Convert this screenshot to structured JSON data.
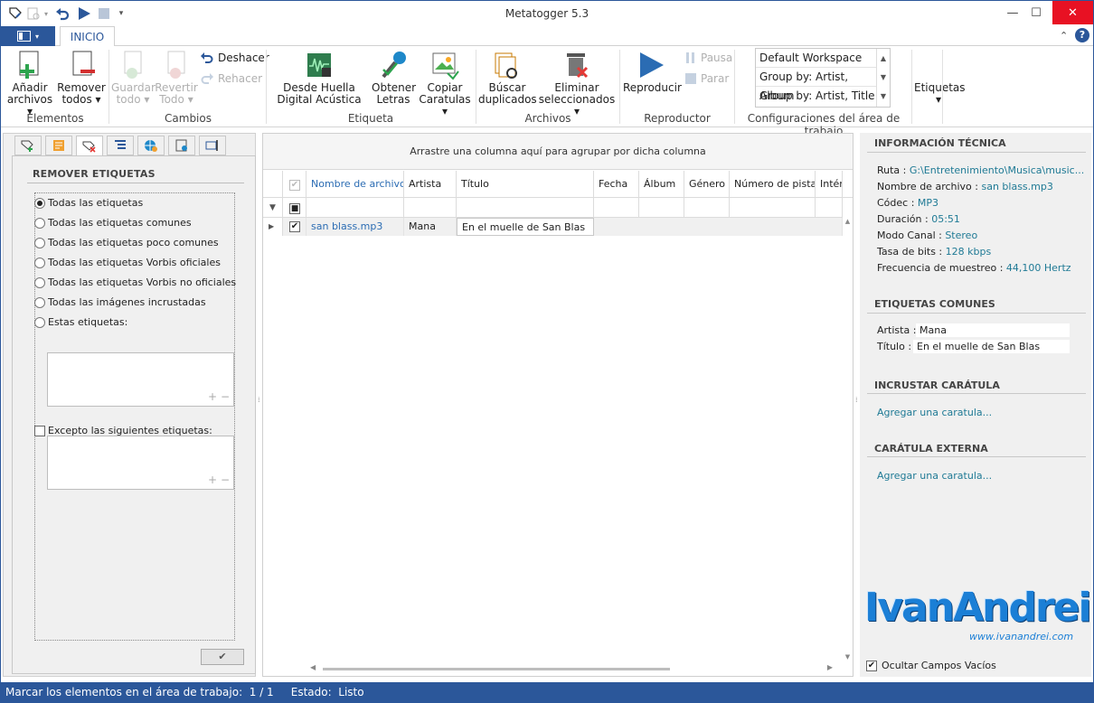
{
  "window": {
    "title": "Metatogger 5.3"
  },
  "ribbon_tabs": {
    "file_label": "",
    "inicio": "INICIO"
  },
  "ribbon": {
    "add_files": "Añadir archivos",
    "remove_all": "Remover todos",
    "save_all": "Guardar todo",
    "revert_all": "Revertir Todo",
    "undo": "Deshacer",
    "redo": "Rehacer",
    "fingerprint": "Desde Huella Digital Acústica",
    "lyrics": "Obtener Letras",
    "covers": "Copiar Caratulas",
    "find_dupes": "Búscar duplicados",
    "delete_selected": "Eliminar seleccionados",
    "play": "Reproducir",
    "pause": "Pausa",
    "stop": "Parar",
    "tags": "Etiquetas",
    "groups": {
      "elementos": "Elementos",
      "cambios": "Cambios",
      "etiqueta": "Etiqueta",
      "archivos": "Archivos",
      "reproductor": "Reproductor",
      "workspace": "Configuraciones del área de trabajo"
    },
    "workspaces": [
      "Default Workspace",
      "Group by: Artist, Album",
      "Group by: Artist, Title"
    ]
  },
  "left_panel": {
    "section_title": "REMOVER ETIQUETAS",
    "options": [
      "Todas las etiquetas",
      "Todas las etiquetas comunes",
      "Todas las etiquetas poco comunes",
      "Todas las etiquetas Vorbis oficiales",
      "Todas las etiquetas Vorbis no oficiales",
      "Todas las imágenes incrustadas",
      "Estas etiquetas:"
    ],
    "selected_index": 0,
    "except_label": "Excepto las siguientes etiquetas:",
    "plus": "+",
    "minus": "−"
  },
  "grid": {
    "group_hint": "Arrastre una columna aquí para agrupar por dicha columna",
    "columns": [
      "Nombre de archivo",
      "Artista",
      "Título",
      "Fecha",
      "Álbum",
      "Género",
      "Número de pista",
      "Intér"
    ],
    "rows": [
      {
        "filename": "san blass.mp3",
        "artist": "Mana",
        "title": "En el muelle de San Blas",
        "checked": true
      }
    ]
  },
  "right_panel": {
    "tech_title": "INFORMACIÓN TÉCNICA",
    "tech": [
      {
        "k": "Ruta : ",
        "v": "G:\\Entretenimiento\\Musica\\music..."
      },
      {
        "k": "Nombre de archivo : ",
        "v": "san blass.mp3"
      },
      {
        "k": "Códec : ",
        "v": "MP3"
      },
      {
        "k": "Duración : ",
        "v": "05:51"
      },
      {
        "k": "Modo Canal : ",
        "v": "Stereo"
      },
      {
        "k": "Tasa de bits : ",
        "v": "128 kbps"
      },
      {
        "k": "Frecuencia de muestreo : ",
        "v": "44,100 Hertz"
      }
    ],
    "common_title": "ETIQUETAS COMUNES",
    "common": [
      {
        "k": "Artista :",
        "v": "Mana"
      },
      {
        "k": "Título :",
        "v": "En el muelle de San Blas"
      }
    ],
    "embed_title": "INCRUSTAR CARÁTULA",
    "embed_link": "Agregar una caratula...",
    "external_title": "CARÁTULA EXTERNA",
    "external_link": "Agregar una caratula...",
    "hide_empty": "Ocultar Campos Vacíos",
    "watermark": "IvanAndrei",
    "watermark_url": "www.ivanandrei.com"
  },
  "status": {
    "text": "Marcar los elementos en el área de trabajo:  1 / 1     Estado:  Listo"
  },
  "colors": {
    "accent": "#2b579a",
    "link": "#1f7a95",
    "close": "#e81123"
  }
}
